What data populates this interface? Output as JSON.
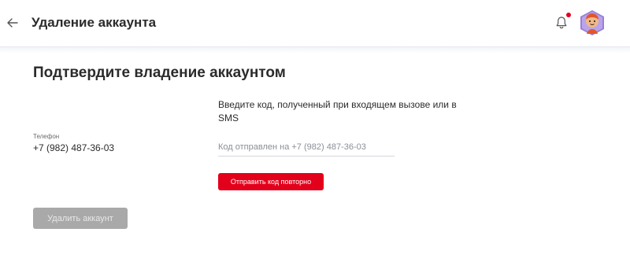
{
  "header": {
    "back_icon": "arrow-left-icon",
    "title": "Удаление аккаунта",
    "notification_icon": "bell-icon",
    "notification_dot_color": "#e3001b",
    "avatar_icon": "user-avatar-icon"
  },
  "main": {
    "heading": "Подтвердите владение аккаунтом",
    "phone": {
      "label": "Телефон",
      "value": "+7 (982) 487-36-03"
    },
    "instruction": "Введите код, полученный при входящем вызове или в SMS",
    "code_input": {
      "value": "",
      "placeholder": "Код отправлен на +7 (982) 487-36-03"
    },
    "resend_button": "Отправить код повторно",
    "delete_button": "Удалить аккаунт"
  },
  "colors": {
    "accent": "#e3001b",
    "disabled_button": "#a9a9a9"
  }
}
